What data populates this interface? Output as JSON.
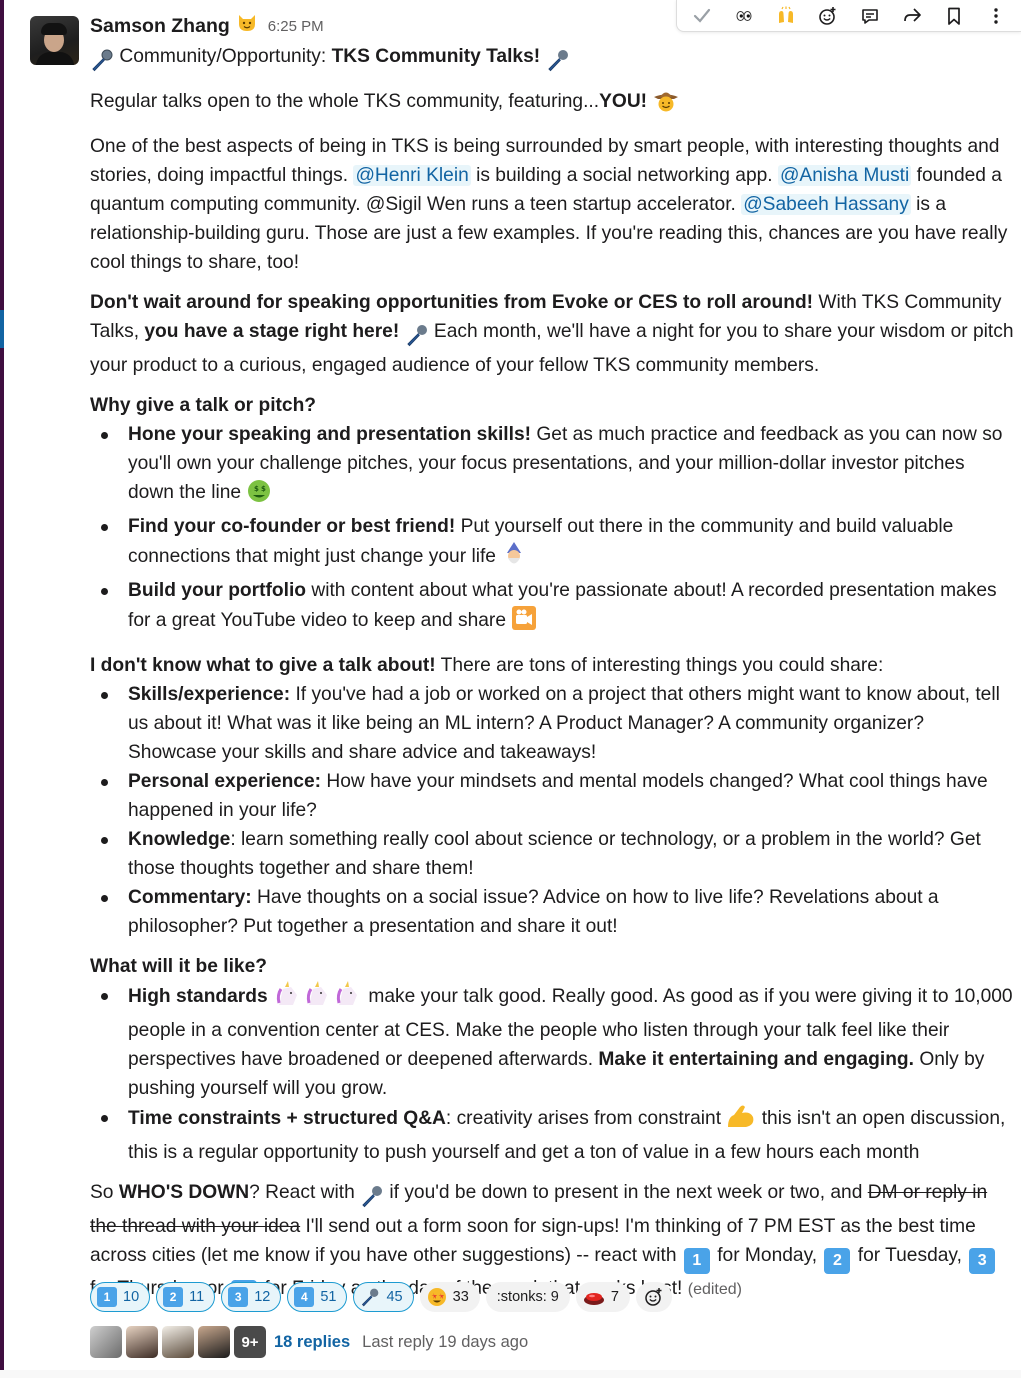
{
  "message": {
    "sender": "Samson Zhang",
    "timestamp": "6:25 PM",
    "title_prefix": "Community/Opportunity:",
    "title_bold": "TKS Community Talks!",
    "intro_text": "Regular talks open to the whole TKS community, featuring...",
    "intro_bold": "YOU!",
    "p1": {
      "t1": "One of the best aspects of being in TKS is being surrounded by smart people, with interesting thoughts and stories, doing impactful things. ",
      "m1": "@Henri Klein",
      "t2": " is building a social networking app. ",
      "m2": "@Anisha Musti",
      "t3": " founded a quantum computing community. @Sigil Wen runs a teen startup accelerator. ",
      "m3": "@Sabeeh Hassany",
      "t4": " is a relationship-building guru. Those are just a few examples. If you're reading this, chances are you have really cool things to share, too!"
    },
    "p2": {
      "b1": "Don't wait around for speaking opportunities from Evoke or CES to roll around!",
      "t1": " With TKS Community Talks, ",
      "b2": "you have a stage right here!",
      "t2": " Each month, we'll have a night for you to share your wisdom or pitch your product to a curious, engaged audience of your fellow TKS community members."
    },
    "why": {
      "heading": "Why give a talk or pitch?",
      "items": [
        {
          "bold": "Hone your speaking and presentation skills!",
          "text": " Get as much practice and feedback as you can now so you'll own your challenge pitches, your focus presentations, and your million-dollar investor pitches down the line"
        },
        {
          "bold": "Find your co-founder or best friend!",
          "text": " Put yourself out there in the community and build valuable connections that might just change your life"
        },
        {
          "bold": "Build your portfolio",
          "text": " with content about what you're passionate about! A recorded presentation makes for a great YouTube video to keep and share"
        }
      ]
    },
    "ideas": {
      "heading_bold": "I don't know what to give a talk about!",
      "heading_text": " There are tons of interesting things you could share:",
      "items": [
        {
          "bold": "Skills/experience:",
          "text": " If you've had a job or worked on a project that others might want to know about, tell us about it! What was it like being an ML intern? A Product Manager? A community organizer? Showcase your skills and share advice and takeaways!"
        },
        {
          "bold": "Personal experience:",
          "text": " How have your mindsets and mental models changed? What cool things have happened in your life?"
        },
        {
          "bold": "Knowledge",
          "text": ": learn something really cool about science or technology, or a problem in the world? Get those thoughts together and share them!"
        },
        {
          "bold": "Commentary:",
          "text": " Have thoughts on a social issue? Advice on how to live life? Revelations about a philosopher? Put together a presentation and share it out!"
        }
      ]
    },
    "like": {
      "heading": "What will it be like?",
      "i1_bold": "High standards",
      "i1_text": " make your talk good. Really good. As good as if you were giving it to 10,000 people in a convention center at CES. Make the people who listen through your talk feel like their perspectives have broadened or deepened afterwards. ",
      "i1_bold2": "Make it entertaining and engaging.",
      "i1_text2": " Only by pushing yourself will you grow.",
      "i2_bold": "Time constraints + structured Q&A",
      "i2_text": ": creativity arises from constraint ",
      "i2_text2": " this isn't an open discussion, this is a regular opportunity to push yourself and get a ton of value in a few hours each month"
    },
    "closing": {
      "t1": "So ",
      "b1": "WHO'S DOWN",
      "t2": "? React with ",
      "t3": " if you'd be down to present in the next week or two, and ",
      "strike": "DM or reply in the thread with your idea",
      "t4": " I'll send out a form soon for sign-ups! I'm thinking of 7 PM EST as the best time across cities (let me know if you have other suggestions) -- react with ",
      "t5": " for Monday, ",
      "t6": " for Tuesday, ",
      "t7": " for Thursday, or ",
      "t8": " for Friday as the day of the week that works best! ",
      "edited": "(edited)"
    }
  },
  "reactions": [
    {
      "emoji": "1",
      "count": "10",
      "active": true
    },
    {
      "emoji": "2",
      "count": "11",
      "active": true
    },
    {
      "emoji": "3",
      "count": "12",
      "active": true
    },
    {
      "emoji": "4",
      "count": "51",
      "active": true
    },
    {
      "emoji": "microphone",
      "count": "45",
      "active": true
    },
    {
      "emoji": "star-struck",
      "count": "33",
      "active": false
    },
    {
      "emoji": ":stonks:",
      "count": "9",
      "active": false
    },
    {
      "emoji": "red-button",
      "count": "7",
      "active": false
    }
  ],
  "thread": {
    "more_count": "9+",
    "replies": "18 replies",
    "last_reply": "Last reply 19 days ago"
  },
  "toolbar": [
    "check-icon",
    "eyes-icon",
    "raised-hands-icon",
    "add-reaction-icon",
    "reply-icon",
    "share-icon",
    "bookmark-icon",
    "more-icon"
  ],
  "colors": {
    "mention": "#1264a3",
    "mention_bg": "#e8f5fa",
    "keycap": "#4aa3e8",
    "sidebar": "#3f0e40"
  }
}
